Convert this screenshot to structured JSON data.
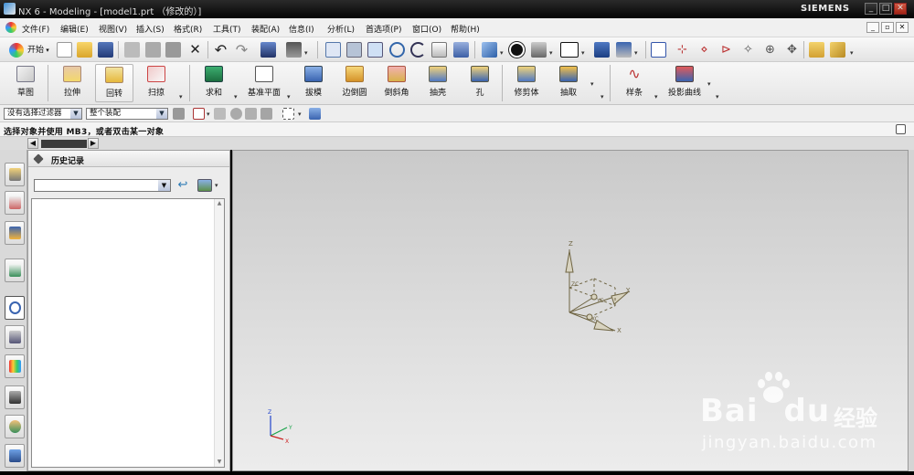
{
  "window": {
    "title": "NX 6 - Modeling - [model1.prt （修改的）]",
    "brand": "SIEMENS",
    "min": "_",
    "max": "□",
    "close": "✕"
  },
  "menubar": {
    "items": [
      "文件(F)",
      "编辑(E)",
      "视图(V)",
      "插入(S)",
      "格式(R)",
      "工具(T)",
      "装配(A)",
      "信息(I)",
      "分析(L)",
      "首选项(P)",
      "窗口(O)",
      "帮助(H)"
    ],
    "mdi": [
      "_",
      "▫",
      "✕"
    ]
  },
  "toolbar1": {
    "start_label": "开始"
  },
  "toolbar2": {
    "buttons": [
      "草图",
      "拉伸",
      "回转",
      "扫掠",
      "求和",
      "基准平面",
      "拔模",
      "边倒圆",
      "倒斜角",
      "抽壳",
      "孔",
      "修剪体",
      "抽取",
      "样条",
      "投影曲线"
    ]
  },
  "toolbar3": {
    "filter_value": "没有选择过滤器",
    "scope_value": "整个装配"
  },
  "status": {
    "message": "选择对象并使用 MB3，或者双击某一对象"
  },
  "navigator": {
    "title": "历史记录"
  },
  "viewport": {
    "csys_labels": {
      "z": "Z",
      "y": "Y",
      "x": "X",
      "zc": "ZC",
      "yc": "YC",
      "xc": "XC"
    },
    "triad_labels": {
      "z": "Z",
      "y": "Y",
      "x": "X"
    }
  },
  "watermark": {
    "brand": "Bai",
    "brand_suffix": "du",
    "cn": "经验",
    "url": "jingyan.baidu.com"
  },
  "colors": {
    "accent": "#3b8fd8",
    "csys": "#6f6543",
    "triad_z": "#2244cc",
    "triad_y": "#1aa34a",
    "triad_x": "#cc2222"
  }
}
